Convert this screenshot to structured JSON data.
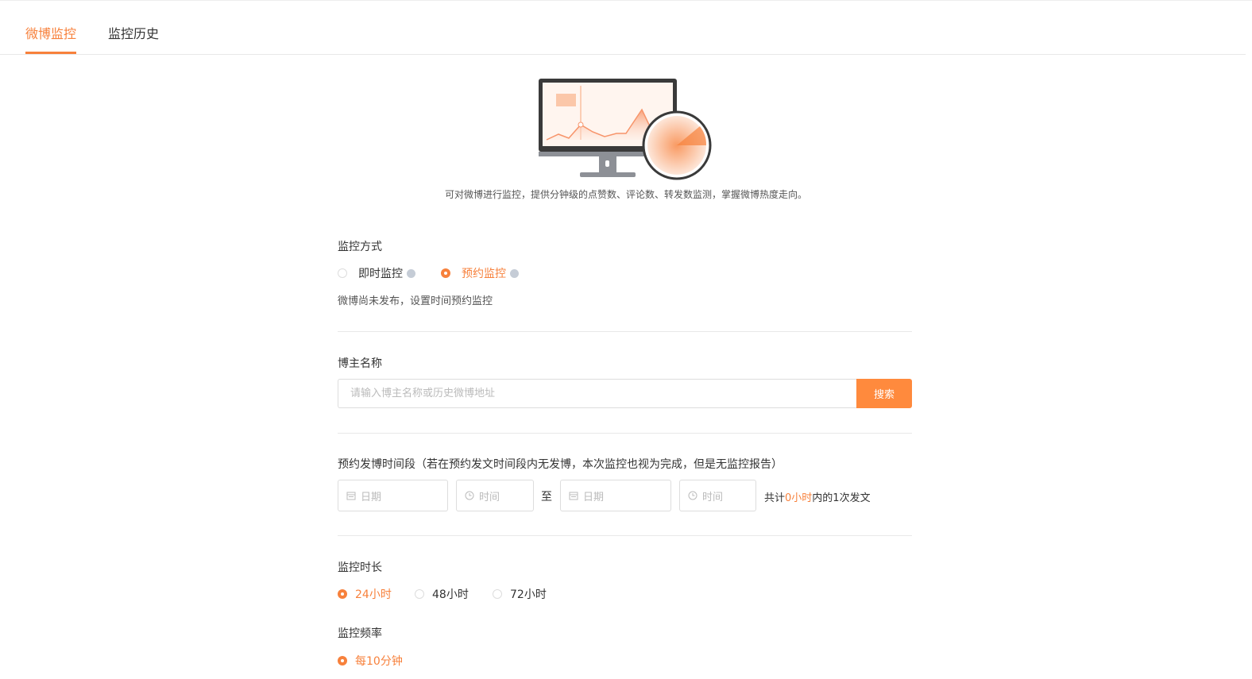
{
  "tabs": [
    {
      "label": "微博监控",
      "active": true
    },
    {
      "label": "监控历史",
      "active": false
    }
  ],
  "intro": {
    "description": "可对微博进行监控，提供分钟级的点赞数、评论数、转发数监测，掌握微博热度走向。"
  },
  "monitor_mode": {
    "label": "监控方式",
    "options": [
      {
        "label": "即时监控",
        "selected": false
      },
      {
        "label": "预约监控",
        "selected": true
      }
    ],
    "hint": "微博尚未发布，设置时间预约监控"
  },
  "blogger": {
    "label": "博主名称",
    "placeholder": "请输入博主名称或历史微博地址",
    "search_label": "搜索"
  },
  "schedule": {
    "label": "预约发博时间段（若在预约发文时间段内无发博，本次监控也视为完成，但是无监控报告）",
    "start_date_placeholder": "日期",
    "start_time_placeholder": "时间",
    "separator": "至",
    "end_date_placeholder": "日期",
    "end_time_placeholder": "时间",
    "summary_prefix": "共计",
    "summary_hours": "0小时",
    "summary_suffix": "内的1次发文"
  },
  "duration": {
    "label": "监控时长",
    "options": [
      {
        "label": "24小时",
        "selected": true
      },
      {
        "label": "48小时",
        "selected": false
      },
      {
        "label": "72小时",
        "selected": false
      }
    ]
  },
  "frequency": {
    "label": "监控频率",
    "options": [
      {
        "label": "每10分钟",
        "selected": true
      }
    ]
  },
  "colors": {
    "accent": "#f7813c"
  }
}
